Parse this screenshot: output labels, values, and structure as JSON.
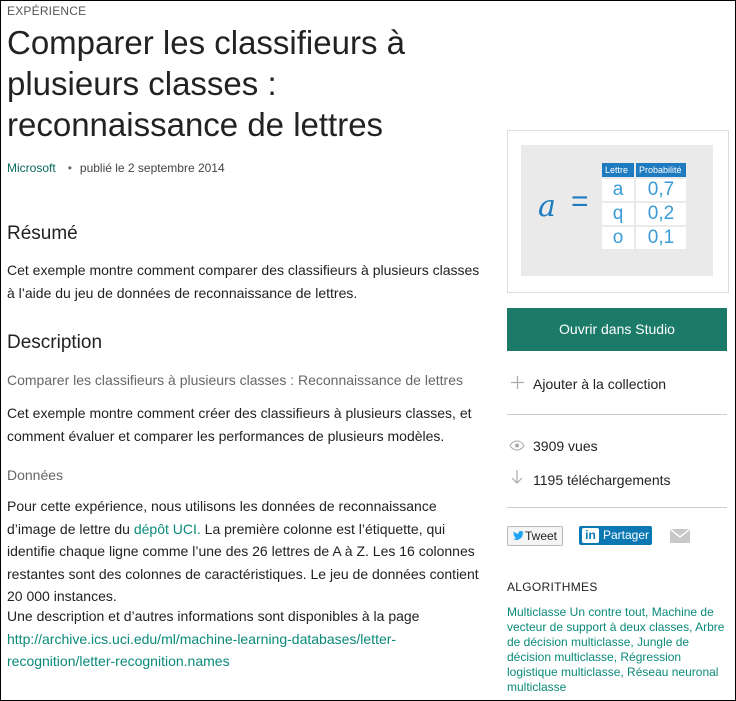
{
  "header": {
    "kicker": "EXPÉRIENCE",
    "title": "Comparer les classifieurs à plusieurs classes : reconnaissance de lettres",
    "author": "Microsoft",
    "dot": "•",
    "published": "publié le 2 septembre 2014"
  },
  "summary": {
    "heading": "Résumé",
    "text": "Cet exemple montre comment comparer des classifieurs à plusieurs classes à l’aide du jeu de données de reconnaissance de lettres."
  },
  "description": {
    "heading": "Description",
    "subheading": "Comparer les classifieurs à plusieurs classes : Reconnaissance de lettres",
    "text": "Cet exemple montre comment créer des classifieurs à plusieurs classes, et comment évaluer et comparer les performances de plusieurs modèles.",
    "data_heading": "Données",
    "data_text_1": "Pour cette expérience, nous utilisons les données de reconnaissance d’image de lettre du ",
    "data_link": "dépôt UCI.",
    "data_text_2": " La première colonne est l’étiquette, qui identifie chaque ligne comme l’une des 26 lettres de A à Z. Les 16 colonnes restantes sont des colonnes de caractéristiques. Le jeu de données contient 20 000 instances.",
    "more_text": "Une description et d’autres informations sont disponibles à la page ",
    "more_link": "http://archive.ics.uci.edu/ml/machine-learning-databases/letter-recognition/letter-recognition.names"
  },
  "thumbnail": {
    "glyph": "a",
    "equals": "=",
    "col_letter": "Lettre",
    "col_prob": "Probabilité",
    "rows": [
      {
        "letter": "a",
        "prob": "0,7"
      },
      {
        "letter": "q",
        "prob": "0,2"
      },
      {
        "letter": "o",
        "prob": "0,1"
      }
    ]
  },
  "sidebar": {
    "open_button": "Ouvrir dans Studio",
    "add_collection": "Ajouter à la collection",
    "views": "3909 vues",
    "downloads": "1195 téléchargements",
    "tweet": "Tweet",
    "share": "Partager",
    "algorithms_heading": "ALGORITHMES",
    "algorithms": "Multiclasse Un contre tout, Machine de vecteur de support à deux classes, Arbre de décision multiclasse, Jungle de décision multiclasse, Régression logistique multiclasse, Réseau neuronal multiclasse"
  },
  "colors": {
    "accent": "#1b7a68",
    "link": "#0a8a7a",
    "thumb_blue": "#1f7bc0",
    "linkedin": "#0b78b4"
  },
  "icons": {
    "add": "plus-icon",
    "views": "eye-icon",
    "downloads": "download-arrow-icon",
    "tweet": "twitter-bird-icon",
    "share": "linkedin-icon",
    "mail": "mail-icon"
  }
}
